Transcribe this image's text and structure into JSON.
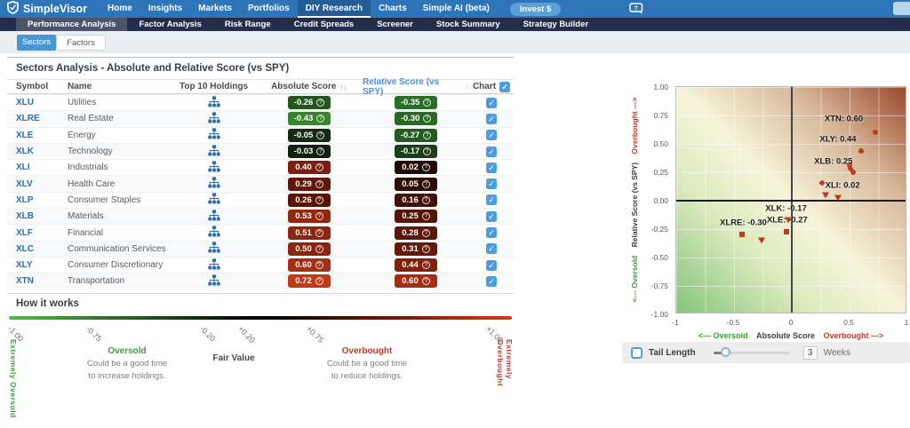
{
  "ui": {
    "check": "✓",
    "info": "?"
  },
  "topnav": {
    "brand": "SimpleVisor",
    "items": [
      "Home",
      "Insights",
      "Markets",
      "Portfolios",
      "DIY Research",
      "Charts",
      "Simple AI (beta)"
    ],
    "active_item": "DIY Research",
    "invest_label": "Invest $"
  },
  "subnav": {
    "items": [
      "Performance Analysis",
      "Factor Analysis",
      "Risk Range",
      "Credit Spreads",
      "Screener",
      "Stock Summary",
      "Strategy Builder"
    ],
    "active_item": "Performance Analysis"
  },
  "tabs": {
    "items": [
      "Sectors",
      "Factors"
    ],
    "active": "Sectors"
  },
  "table": {
    "title": "Sectors Analysis - Absolute and Relative Score (vs SPY)",
    "columns": {
      "symbol": "Symbol",
      "name": "Name",
      "holdings": "Top 10 Holdings",
      "abs": "Absolute Score",
      "rel": "Relative Score (vs SPY)",
      "chart": "Chart"
    },
    "sort_icon_abs": "↑↓",
    "sort_icon_rel": "↑",
    "rows": [
      {
        "symbol": "XLU",
        "name": "Utilities",
        "abs": "-0.26",
        "abs_color": "#23551f",
        "rel": "-0.35",
        "rel_color": "#2c6e27",
        "checked": true
      },
      {
        "symbol": "XLRE",
        "name": "Real Estate",
        "abs": "-0.43",
        "abs_color": "#37842f",
        "rel": "-0.30",
        "rel_color": "#2a6825",
        "checked": true
      },
      {
        "symbol": "XLE",
        "name": "Energy",
        "abs": "-0.05",
        "abs_color": "#132b11",
        "rel": "-0.27",
        "rel_color": "#245c20",
        "checked": true
      },
      {
        "symbol": "XLK",
        "name": "Technology",
        "abs": "-0.03",
        "abs_color": "#10200e",
        "rel": "-0.17",
        "rel_color": "#1a3f17",
        "checked": true
      },
      {
        "symbol": "XLI",
        "name": "Industrials",
        "abs": "0.40",
        "abs_color": "#7c1e0b",
        "rel": "0.02",
        "rel_color": "#200a04",
        "checked": true
      },
      {
        "symbol": "XLV",
        "name": "Health Care",
        "abs": "0.29",
        "abs_color": "#5e1708",
        "rel": "0.05",
        "rel_color": "#2b0d04",
        "checked": true
      },
      {
        "symbol": "XLP",
        "name": "Consumer Staples",
        "abs": "0.26",
        "abs_color": "#571505",
        "rel": "0.16",
        "rel_color": "#431105",
        "checked": true
      },
      {
        "symbol": "XLB",
        "name": "Materials",
        "abs": "0.53",
        "abs_color": "#93260e",
        "rel": "0.25",
        "rel_color": "#541505",
        "checked": true
      },
      {
        "symbol": "XLF",
        "name": "Financial",
        "abs": "0.51",
        "abs_color": "#8f250d",
        "rel": "0.28",
        "rel_color": "#5c1707",
        "checked": true
      },
      {
        "symbol": "XLC",
        "name": "Communication Services",
        "abs": "0.50",
        "abs_color": "#8d240d",
        "rel": "0.31",
        "rel_color": "#651a08",
        "checked": true
      },
      {
        "symbol": "XLY",
        "name": "Consumer Discretionary",
        "abs": "0.60",
        "abs_color": "#a52d12",
        "rel": "0.44",
        "rel_color": "#832009",
        "checked": true
      },
      {
        "symbol": "XTN",
        "name": "Transportation",
        "abs": "0.72",
        "abs_color": "#c13a16",
        "rel": "0.60",
        "rel_color": "#a52d12",
        "checked": true
      }
    ]
  },
  "how_it_works": {
    "title": "How it works",
    "scale_ticks": [
      {
        "text": "-1.00",
        "pos": 1
      },
      {
        "text": "-0.75",
        "pos": 16.5
      },
      {
        "text": "-0.20",
        "pos": 39
      },
      {
        "text": "+0.20",
        "pos": 46.5
      },
      {
        "text": "+0.75",
        "pos": 60
      },
      {
        "text": "+1.00",
        "pos": 95.5
      }
    ],
    "left_vertical": "Extremely Oversold",
    "right_vertical": "Extremely Overbought",
    "oversold": {
      "title": "Oversold",
      "line1": "Could be a good time",
      "line2": "to increase holdings."
    },
    "fair": {
      "title": "Fair Value"
    },
    "overbought": {
      "title": "Overbought",
      "line1": "Could be a good time",
      "line2": "to reduce holdings."
    }
  },
  "chart_data": {
    "type": "scatter",
    "xlabel": "Absolute Score",
    "ylabel": "Relative Score (vs SPY)",
    "oversold_x": "<--- Oversold",
    "overbought_x": "Overbought --->",
    "oversold_y": "<--- Oversold",
    "overbought_y": "Overbought --->",
    "xlim": [
      -1,
      1
    ],
    "ylim": [
      -1,
      1
    ],
    "grid": true,
    "x_ticks": [
      "-1",
      "-0.5",
      "0",
      "0.5",
      "1"
    ],
    "y_ticks": [
      "1.00",
      "0.75",
      "0.50",
      "0.25",
      "0.00",
      "-0.25",
      "-0.50",
      "-0.75",
      "-1.00"
    ],
    "points": [
      {
        "symbol": "XLU",
        "x": -0.26,
        "y": -0.35,
        "marker": "triangle"
      },
      {
        "symbol": "XLRE",
        "x": -0.43,
        "y": -0.3,
        "marker": "square"
      },
      {
        "symbol": "XLE",
        "x": -0.05,
        "y": -0.27,
        "marker": "square"
      },
      {
        "symbol": "XLK",
        "x": -0.03,
        "y": -0.17,
        "marker": "triangle"
      },
      {
        "symbol": "XLI",
        "x": 0.4,
        "y": 0.02,
        "marker": "triangle"
      },
      {
        "symbol": "XLV",
        "x": 0.29,
        "y": 0.05,
        "marker": "triangle"
      },
      {
        "symbol": "XLP",
        "x": 0.26,
        "y": 0.16,
        "marker": "diamond"
      },
      {
        "symbol": "XLB",
        "x": 0.53,
        "y": 0.25,
        "marker": "circle"
      },
      {
        "symbol": "XLF",
        "x": 0.51,
        "y": 0.28,
        "marker": "diamond"
      },
      {
        "symbol": "XLC",
        "x": 0.5,
        "y": 0.31,
        "marker": "circle"
      },
      {
        "symbol": "XLY",
        "x": 0.6,
        "y": 0.44,
        "marker": "circle"
      },
      {
        "symbol": "XTN",
        "x": 0.72,
        "y": 0.6,
        "marker": "circle"
      }
    ],
    "annotations": [
      {
        "text": "XTN: 0.60",
        "x": 0.45,
        "y": 0.72
      },
      {
        "text": "XLY: 0.44",
        "x": 0.4,
        "y": 0.54
      },
      {
        "text": "XLB: 0.25",
        "x": 0.36,
        "y": 0.34
      },
      {
        "text": "XLI: 0.02",
        "x": 0.44,
        "y": 0.13
      },
      {
        "text": "XLK: -0.17",
        "x": -0.05,
        "y": -0.07
      },
      {
        "text": "XLE: -0.27",
        "x": -0.04,
        "y": -0.175
      },
      {
        "text": "XLRE: -0.30",
        "x": -0.42,
        "y": -0.195
      }
    ]
  },
  "tail": {
    "label": "Tail Length",
    "value": "3",
    "unit": "Weeks"
  }
}
